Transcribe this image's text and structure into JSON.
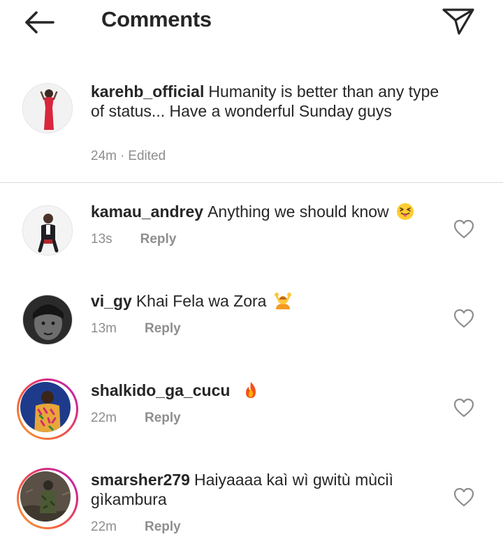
{
  "header": {
    "title": "Comments",
    "back_icon": "arrow-left-icon",
    "share_icon": "paper-plane-icon"
  },
  "caption": {
    "username": "karehb_official",
    "text": "Humanity is better than any type of status... Have a wonderful Sunday guys",
    "time": "24m",
    "separator": "·",
    "edited": "Edited"
  },
  "comments": [
    {
      "username": "kamau_andrey",
      "text": "Anything we should know",
      "emoji": "squinting-tongue-emoji",
      "time": "13s",
      "reply": "Reply",
      "story_ring": false
    },
    {
      "username": "vi_gy",
      "text": "Khai Fela wa Zora",
      "emoji": "person-gesturing-ok-emoji",
      "time": "13m",
      "reply": "Reply",
      "story_ring": false
    },
    {
      "username": "shalkido_ga_cucu",
      "text": "",
      "emoji": "fire-emoji",
      "time": "22m",
      "reply": "Reply",
      "story_ring": true
    },
    {
      "username": "smarsher279",
      "text": "Haiyaaaa kaì wì gwitù mùciì gìkambura",
      "emoji": "",
      "time": "22m",
      "reply": "Reply",
      "story_ring": true
    }
  ],
  "colors": {
    "text": "#262626",
    "secondary": "#8e8e8e",
    "divider": "#dbdbdb",
    "ring_start": "#f9a23a",
    "ring_end": "#a82bc4"
  }
}
